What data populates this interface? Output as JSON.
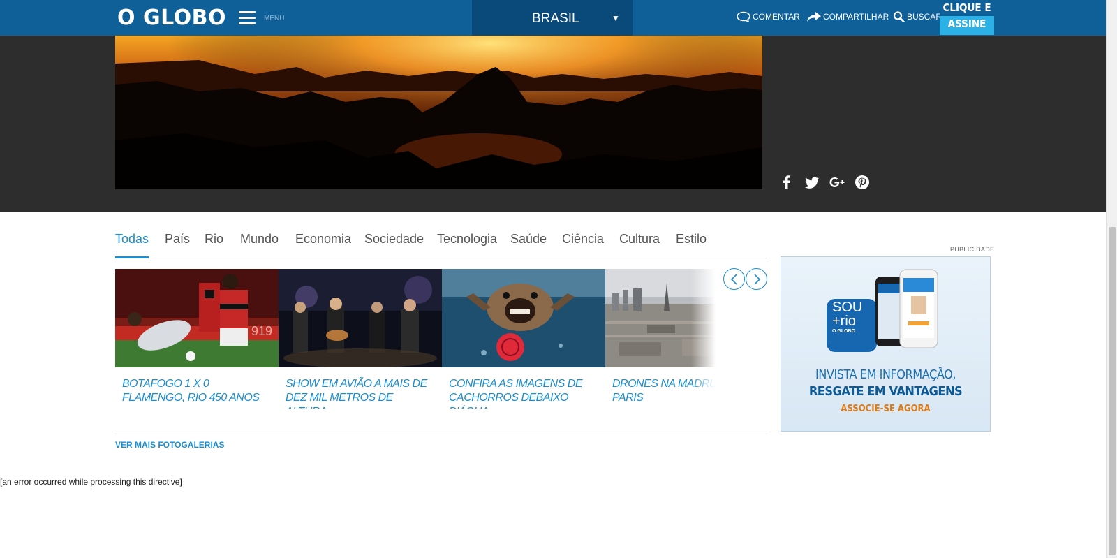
{
  "header": {
    "logo": "O GLOBO",
    "menu_label": "MENU",
    "section": "BRASIL",
    "actions": {
      "comment": "COMENTAR",
      "share": "COMPARTILHAR",
      "search": "BUSCAR"
    },
    "subscribe": {
      "line1": "CLIQUE E",
      "line2": "ASSINE"
    }
  },
  "tabs": [
    "Todas",
    "País",
    "Rio",
    "Mundo",
    "Economia",
    "Sociedade",
    "Tecnologia",
    "Saúde",
    "Ciência",
    "Cultura",
    "Estilo"
  ],
  "gallery": [
    {
      "caption": "BOTAFOGO 1 X 0 FLAMENGO, RIO 450 ANOS"
    },
    {
      "caption": "SHOW EM AVIÃO A MAIS DE DEZ MIL METROS DE ALTURA"
    },
    {
      "caption": "CONFIRA AS IMAGENS DE CACHORROS DEBAIXO D'ÁGUA"
    },
    {
      "caption": "DRONES NA MADRUGADA PARIS"
    }
  ],
  "more_galleries": "VER MAIS FOTOGALERIAS",
  "error_text": "[an error occurred while processing this directive]",
  "ad": {
    "label": "PUBLICIDADE",
    "line1": "INVISTA EM INFORMAÇÃO,",
    "line2": "RESGATE EM VANTAGENS",
    "line3": "ASSOCIE-SE AGORA",
    "app_name_1": "SOU",
    "app_name_2": "+rio",
    "app_brand": "O GLOBO"
  },
  "social_icons": [
    "facebook-icon",
    "twitter-icon",
    "google-plus-icon",
    "pinterest-icon"
  ],
  "colors": {
    "header_bg": "#0f5f99",
    "accent": "#1a8ed1",
    "subscribe_bg": "#2bb1e6",
    "hero_band": "#2d2d2d"
  }
}
